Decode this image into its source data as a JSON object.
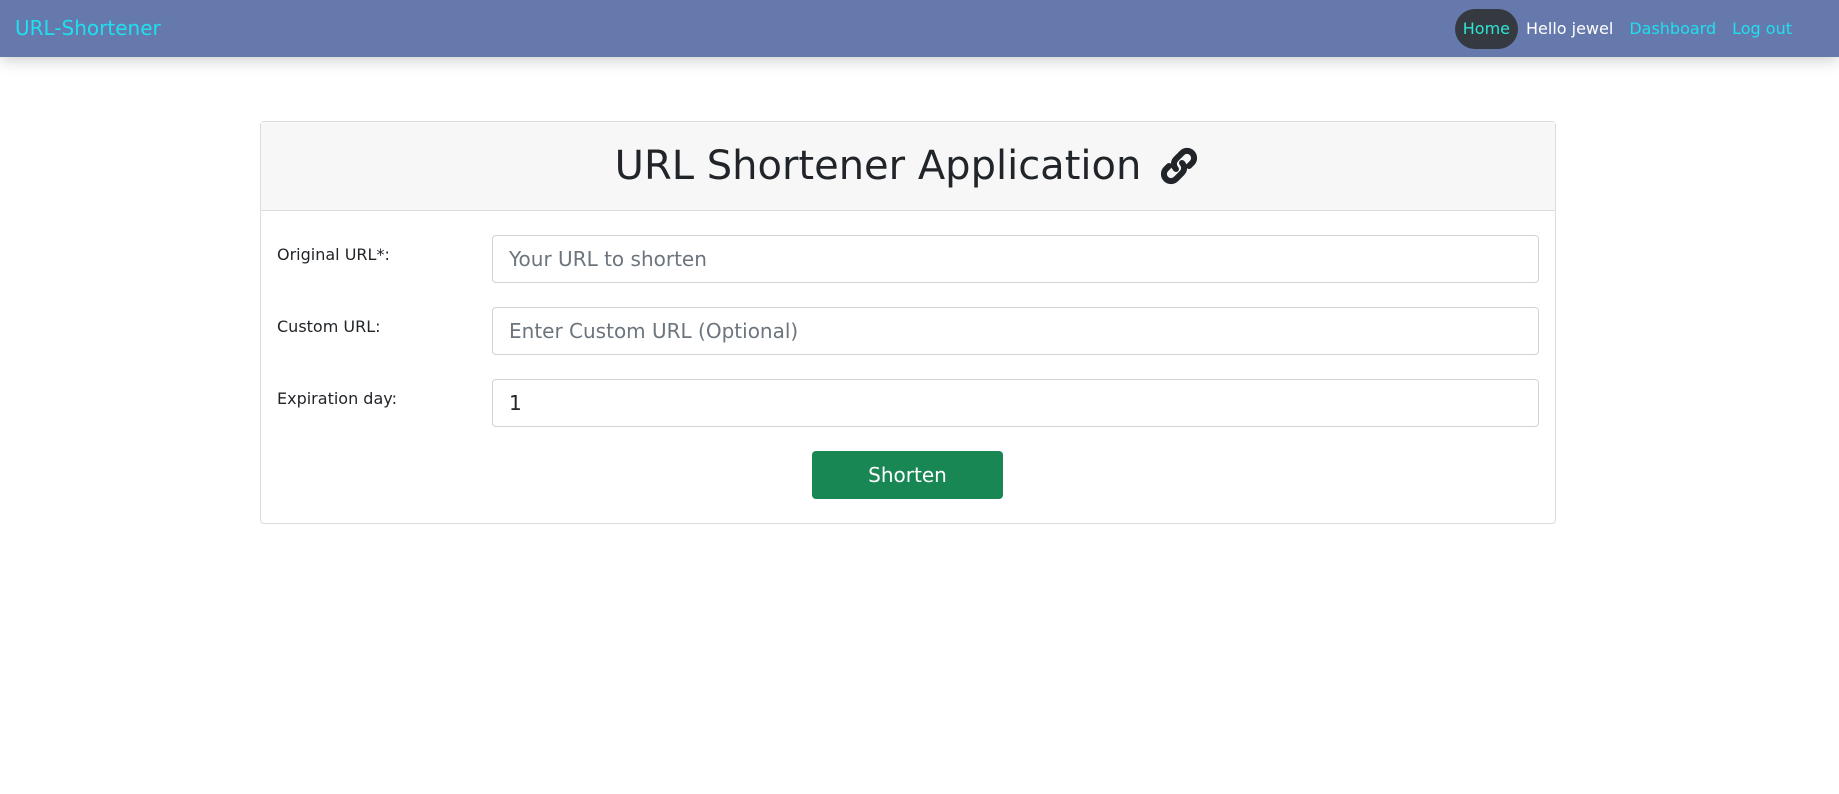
{
  "navbar": {
    "brand": "URL-Shortener",
    "links": {
      "home": "Home",
      "greeting": "Hello jewel",
      "dashboard": "Dashboard",
      "logout": "Log out"
    },
    "colors": {
      "background": "#6679ad",
      "link": "#1ee0ee",
      "active_pill": "#343a40"
    }
  },
  "card": {
    "title": "URL Shortener Application",
    "title_icon": "link-icon",
    "fields": {
      "original_url": {
        "label": "Original URL*:",
        "placeholder": "Your URL to shorten",
        "value": ""
      },
      "custom_url": {
        "label": "Custom URL:",
        "placeholder": "Enter Custom URL (Optional)",
        "value": ""
      },
      "expiration": {
        "label": "Expiration day:",
        "placeholder": "",
        "value": "1"
      }
    },
    "submit_label": "Shorten",
    "submit_color": "#198754"
  }
}
